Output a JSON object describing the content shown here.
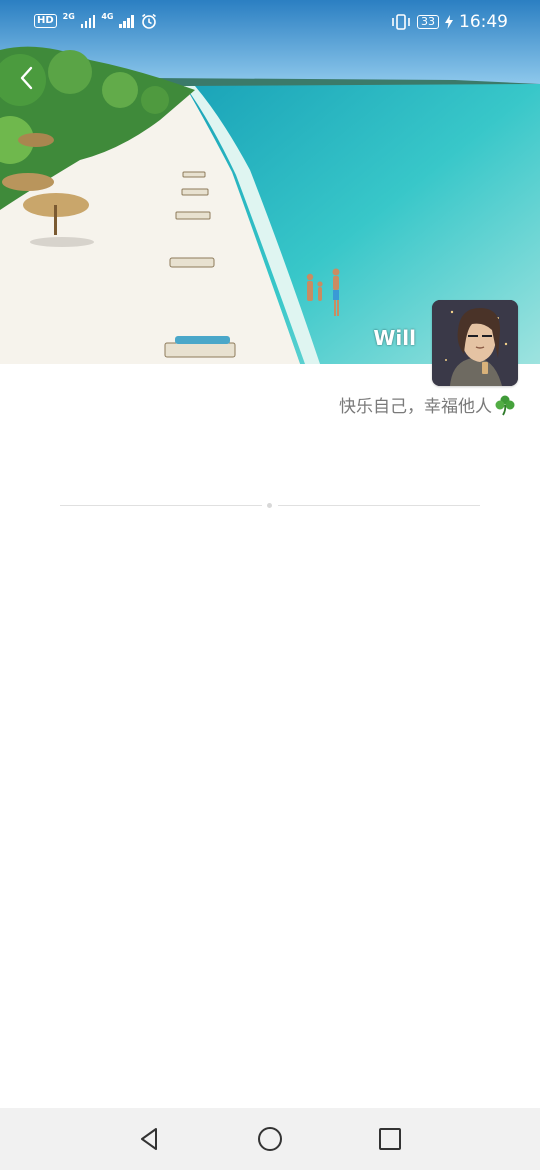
{
  "status_bar": {
    "hd_label": "HD",
    "net_1": "2G",
    "net_2": "4G",
    "battery": "33",
    "time": "16:49",
    "icons": [
      "hd-icon",
      "signal-icon",
      "alarm-icon",
      "vibrate-icon",
      "battery-icon",
      "charging-icon"
    ]
  },
  "header": {
    "back_icon": "chevron-left-icon"
  },
  "profile": {
    "username": "Will",
    "signature": "快乐自己，幸福他人",
    "signature_emoji_icon": "shamrock-icon"
  },
  "navigation_bar": {
    "icons": [
      "back-triangle-icon",
      "home-circle-icon",
      "recents-square-icon"
    ]
  },
  "colors": {
    "sea": "#3fc6c8",
    "sand": "#f4f1ea",
    "nav_bg": "#f1f1f1",
    "signature_text": "#7a7a7a"
  }
}
